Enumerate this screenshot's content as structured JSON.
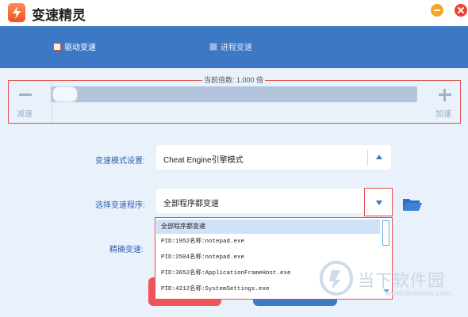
{
  "app": {
    "title": "变速精灵",
    "colors": {
      "primary": "#3d78c4",
      "accent": "#e05050",
      "logo": "#f0522a"
    }
  },
  "window_controls": {
    "minimize": "minimize-icon",
    "close": "close-icon"
  },
  "nav": {
    "tabs": [
      {
        "label": "驱动变速",
        "icon": "driver-icon",
        "active": true
      },
      {
        "label": "进程变速",
        "icon": "process-icon",
        "active": false
      }
    ]
  },
  "speed": {
    "current_label": "当前倍数: 1.000 倍",
    "decrease_label": "减速",
    "increase_label": "加速",
    "slider_level_fraction": 0.0
  },
  "settings": {
    "mode_label": "变速模式设置:",
    "mode_value": "Cheat Engine引擎模式",
    "program_label": "选择变速程序:",
    "program_value": "全部程序都变速",
    "precise_label": "精确变速:"
  },
  "program_dropdown": {
    "options": [
      "全部程序都变速",
      "PID:1952名称:notepad.exe",
      "PID:2504名称:notepad.exe",
      "PID:3652名称:ApplicationFrameHost.exe",
      "PID:4212名称:SystemSettings.exe"
    ],
    "selected_index": 0
  },
  "watermark": {
    "text": "当下软件园",
    "url": "www.downxia.com"
  }
}
